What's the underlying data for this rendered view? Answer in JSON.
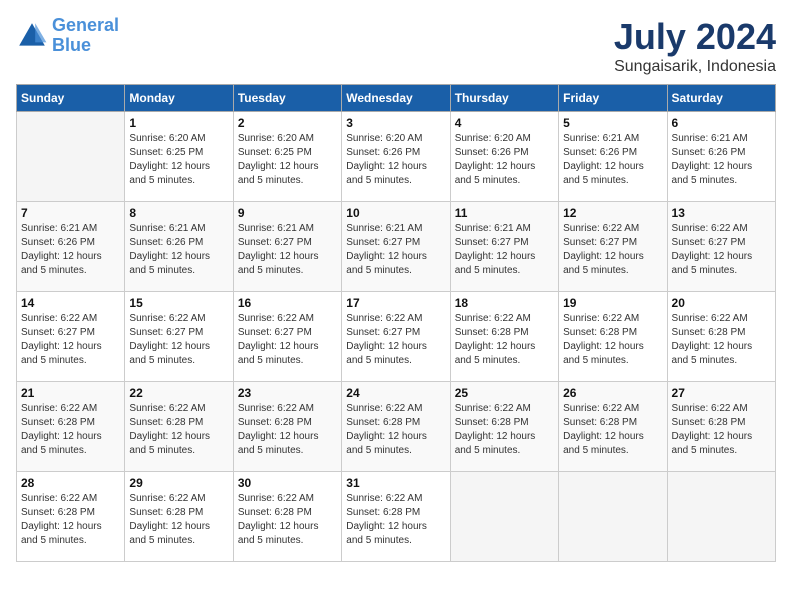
{
  "header": {
    "logo_line1": "General",
    "logo_line2": "Blue",
    "month": "July 2024",
    "location": "Sungaisarik, Indonesia"
  },
  "weekdays": [
    "Sunday",
    "Monday",
    "Tuesday",
    "Wednesday",
    "Thursday",
    "Friday",
    "Saturday"
  ],
  "weeks": [
    [
      {
        "day": "",
        "sunrise": "",
        "sunset": "",
        "daylight": "",
        "empty": true
      },
      {
        "day": "1",
        "sunrise": "Sunrise: 6:20 AM",
        "sunset": "Sunset: 6:25 PM",
        "daylight": "Daylight: 12 hours and 5 minutes."
      },
      {
        "day": "2",
        "sunrise": "Sunrise: 6:20 AM",
        "sunset": "Sunset: 6:25 PM",
        "daylight": "Daylight: 12 hours and 5 minutes."
      },
      {
        "day": "3",
        "sunrise": "Sunrise: 6:20 AM",
        "sunset": "Sunset: 6:26 PM",
        "daylight": "Daylight: 12 hours and 5 minutes."
      },
      {
        "day": "4",
        "sunrise": "Sunrise: 6:20 AM",
        "sunset": "Sunset: 6:26 PM",
        "daylight": "Daylight: 12 hours and 5 minutes."
      },
      {
        "day": "5",
        "sunrise": "Sunrise: 6:21 AM",
        "sunset": "Sunset: 6:26 PM",
        "daylight": "Daylight: 12 hours and 5 minutes."
      },
      {
        "day": "6",
        "sunrise": "Sunrise: 6:21 AM",
        "sunset": "Sunset: 6:26 PM",
        "daylight": "Daylight: 12 hours and 5 minutes."
      }
    ],
    [
      {
        "day": "7",
        "sunrise": "Sunrise: 6:21 AM",
        "sunset": "Sunset: 6:26 PM",
        "daylight": "Daylight: 12 hours and 5 minutes."
      },
      {
        "day": "8",
        "sunrise": "Sunrise: 6:21 AM",
        "sunset": "Sunset: 6:26 PM",
        "daylight": "Daylight: 12 hours and 5 minutes."
      },
      {
        "day": "9",
        "sunrise": "Sunrise: 6:21 AM",
        "sunset": "Sunset: 6:27 PM",
        "daylight": "Daylight: 12 hours and 5 minutes."
      },
      {
        "day": "10",
        "sunrise": "Sunrise: 6:21 AM",
        "sunset": "Sunset: 6:27 PM",
        "daylight": "Daylight: 12 hours and 5 minutes."
      },
      {
        "day": "11",
        "sunrise": "Sunrise: 6:21 AM",
        "sunset": "Sunset: 6:27 PM",
        "daylight": "Daylight: 12 hours and 5 minutes."
      },
      {
        "day": "12",
        "sunrise": "Sunrise: 6:22 AM",
        "sunset": "Sunset: 6:27 PM",
        "daylight": "Daylight: 12 hours and 5 minutes."
      },
      {
        "day": "13",
        "sunrise": "Sunrise: 6:22 AM",
        "sunset": "Sunset: 6:27 PM",
        "daylight": "Daylight: 12 hours and 5 minutes."
      }
    ],
    [
      {
        "day": "14",
        "sunrise": "Sunrise: 6:22 AM",
        "sunset": "Sunset: 6:27 PM",
        "daylight": "Daylight: 12 hours and 5 minutes."
      },
      {
        "day": "15",
        "sunrise": "Sunrise: 6:22 AM",
        "sunset": "Sunset: 6:27 PM",
        "daylight": "Daylight: 12 hours and 5 minutes."
      },
      {
        "day": "16",
        "sunrise": "Sunrise: 6:22 AM",
        "sunset": "Sunset: 6:27 PM",
        "daylight": "Daylight: 12 hours and 5 minutes."
      },
      {
        "day": "17",
        "sunrise": "Sunrise: 6:22 AM",
        "sunset": "Sunset: 6:27 PM",
        "daylight": "Daylight: 12 hours and 5 minutes."
      },
      {
        "day": "18",
        "sunrise": "Sunrise: 6:22 AM",
        "sunset": "Sunset: 6:28 PM",
        "daylight": "Daylight: 12 hours and 5 minutes."
      },
      {
        "day": "19",
        "sunrise": "Sunrise: 6:22 AM",
        "sunset": "Sunset: 6:28 PM",
        "daylight": "Daylight: 12 hours and 5 minutes."
      },
      {
        "day": "20",
        "sunrise": "Sunrise: 6:22 AM",
        "sunset": "Sunset: 6:28 PM",
        "daylight": "Daylight: 12 hours and 5 minutes."
      }
    ],
    [
      {
        "day": "21",
        "sunrise": "Sunrise: 6:22 AM",
        "sunset": "Sunset: 6:28 PM",
        "daylight": "Daylight: 12 hours and 5 minutes."
      },
      {
        "day": "22",
        "sunrise": "Sunrise: 6:22 AM",
        "sunset": "Sunset: 6:28 PM",
        "daylight": "Daylight: 12 hours and 5 minutes."
      },
      {
        "day": "23",
        "sunrise": "Sunrise: 6:22 AM",
        "sunset": "Sunset: 6:28 PM",
        "daylight": "Daylight: 12 hours and 5 minutes."
      },
      {
        "day": "24",
        "sunrise": "Sunrise: 6:22 AM",
        "sunset": "Sunset: 6:28 PM",
        "daylight": "Daylight: 12 hours and 5 minutes."
      },
      {
        "day": "25",
        "sunrise": "Sunrise: 6:22 AM",
        "sunset": "Sunset: 6:28 PM",
        "daylight": "Daylight: 12 hours and 5 minutes."
      },
      {
        "day": "26",
        "sunrise": "Sunrise: 6:22 AM",
        "sunset": "Sunset: 6:28 PM",
        "daylight": "Daylight: 12 hours and 5 minutes."
      },
      {
        "day": "27",
        "sunrise": "Sunrise: 6:22 AM",
        "sunset": "Sunset: 6:28 PM",
        "daylight": "Daylight: 12 hours and 5 minutes."
      }
    ],
    [
      {
        "day": "28",
        "sunrise": "Sunrise: 6:22 AM",
        "sunset": "Sunset: 6:28 PM",
        "daylight": "Daylight: 12 hours and 5 minutes."
      },
      {
        "day": "29",
        "sunrise": "Sunrise: 6:22 AM",
        "sunset": "Sunset: 6:28 PM",
        "daylight": "Daylight: 12 hours and 5 minutes."
      },
      {
        "day": "30",
        "sunrise": "Sunrise: 6:22 AM",
        "sunset": "Sunset: 6:28 PM",
        "daylight": "Daylight: 12 hours and 5 minutes."
      },
      {
        "day": "31",
        "sunrise": "Sunrise: 6:22 AM",
        "sunset": "Sunset: 6:28 PM",
        "daylight": "Daylight: 12 hours and 5 minutes."
      },
      {
        "day": "",
        "sunrise": "",
        "sunset": "",
        "daylight": "",
        "empty": true
      },
      {
        "day": "",
        "sunrise": "",
        "sunset": "",
        "daylight": "",
        "empty": true
      },
      {
        "day": "",
        "sunrise": "",
        "sunset": "",
        "daylight": "",
        "empty": true
      }
    ]
  ]
}
